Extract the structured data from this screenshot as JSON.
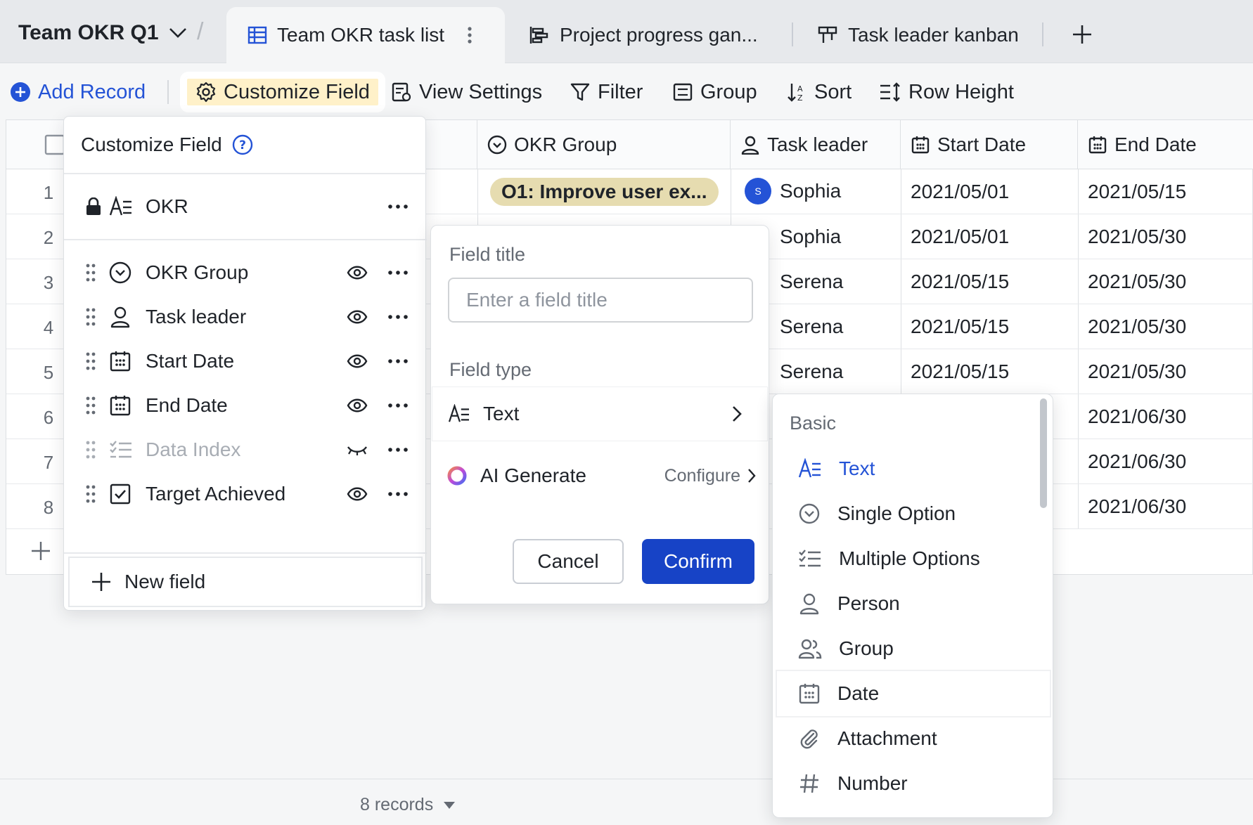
{
  "tabs": {
    "base_name": "Team OKR Q1",
    "items": [
      {
        "label": "Team OKR task list",
        "icon": "grid-table-icon"
      },
      {
        "label": "Project progress gan...",
        "icon": "gantt-icon"
      },
      {
        "label": "Task leader kanban",
        "icon": "kanban-icon"
      }
    ]
  },
  "toolbar": {
    "add_record": "Add Record",
    "customize_field": "Customize Field",
    "view_settings": "View Settings",
    "filter": "Filter",
    "group": "Group",
    "sort": "Sort",
    "row_height": "Row Height"
  },
  "grid": {
    "headers": {
      "okr_group": "OKR Group",
      "task_leader": "Task leader",
      "start_date": "Start Date",
      "end_date": "End Date"
    },
    "rows": [
      {
        "num": "1",
        "okr_group": "O1: Improve user ex...",
        "leader": "Sophia",
        "avatar": "S",
        "start": "2021/05/01",
        "end": "2021/05/15"
      },
      {
        "num": "2",
        "okr_group": "",
        "leader": "Sophia",
        "avatar": "S",
        "start": "2021/05/01",
        "end": "2021/05/30"
      },
      {
        "num": "3",
        "okr_group": "",
        "leader": "Serena",
        "avatar": "",
        "start": "2021/05/15",
        "end": "2021/05/30"
      },
      {
        "num": "4",
        "okr_group": "",
        "leader": "Serena",
        "avatar": "",
        "start": "2021/05/15",
        "end": "2021/05/30"
      },
      {
        "num": "5",
        "okr_group": "",
        "leader": "Serena",
        "avatar": "",
        "start": "2021/05/15",
        "end": "2021/05/30"
      },
      {
        "num": "6",
        "okr_group": "",
        "leader": "",
        "avatar": "",
        "start": "",
        "end": "2021/06/30"
      },
      {
        "num": "7",
        "okr_group": "",
        "leader": "",
        "avatar": "",
        "start": "",
        "end": "2021/06/30"
      },
      {
        "num": "8",
        "okr_group": "",
        "leader": "",
        "avatar": "",
        "start": "",
        "end": "2021/06/30"
      }
    ]
  },
  "footer": {
    "records": "8 records"
  },
  "customize_panel": {
    "title": "Customize Field",
    "primary_field": "OKR",
    "fields": [
      {
        "label": "OKR Group",
        "visible": true
      },
      {
        "label": "Task leader",
        "visible": true
      },
      {
        "label": "Start Date",
        "visible": true
      },
      {
        "label": "End Date",
        "visible": true
      },
      {
        "label": "Data Index",
        "visible": false
      },
      {
        "label": "Target Achieved",
        "visible": true
      }
    ],
    "new_field": "New field"
  },
  "field_editor": {
    "title_label": "Field title",
    "title_placeholder": "Enter a field title",
    "type_label": "Field type",
    "selected_type": "Text",
    "ai_generate": "AI Generate",
    "configure": "Configure",
    "cancel": "Cancel",
    "confirm": "Confirm"
  },
  "type_list": {
    "section": "Basic",
    "items": [
      "Text",
      "Single Option",
      "Multiple Options",
      "Person",
      "Group",
      "Date",
      "Attachment",
      "Number"
    ]
  },
  "colors": {
    "accent": "#2453d6",
    "confirm_bg": "#1743c6",
    "highlight": "#fff1c9",
    "okr_pill": "#e6dcb0"
  }
}
